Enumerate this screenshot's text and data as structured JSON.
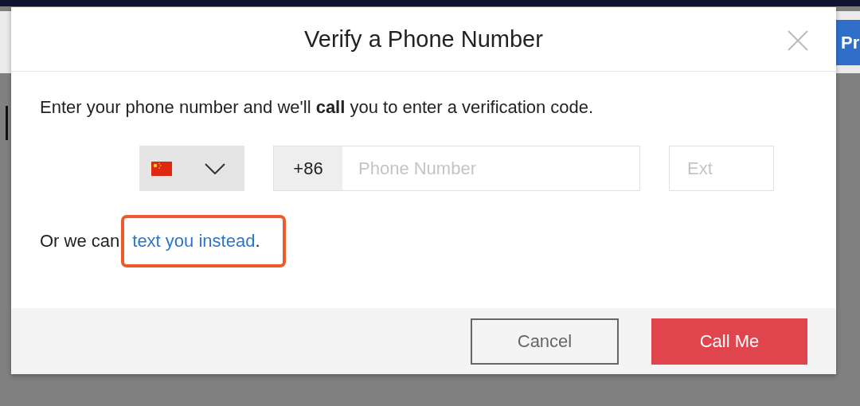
{
  "background": {
    "button": "Pr"
  },
  "dialog": {
    "title": "Verify a Phone Number",
    "instructions": "Enter your phone number and we'll **call** you to enter a verification code.",
    "phone": {
      "country_code": "+86",
      "placeholder": "Phone Number",
      "extension_placeholder": "Ext"
    },
    "alternative": {
      "text": "Or we can",
      "link": "text you instead",
      "end": "."
    },
    "buttons": [
      {
        "label": "Cancel",
        "kind": "secondary"
      },
      {
        "label": "Call Me",
        "kind": "primary"
      }
    ]
  }
}
